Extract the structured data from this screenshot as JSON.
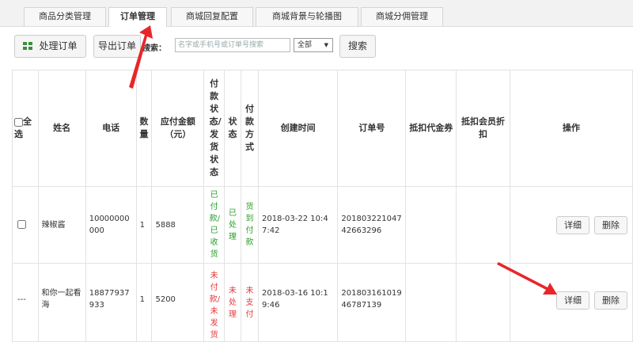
{
  "tabs": [
    {
      "label": "商品分类管理"
    },
    {
      "label": "订单管理"
    },
    {
      "label": "商城回复配置"
    },
    {
      "label": "商城背景与轮播图"
    },
    {
      "label": "商城分佣管理"
    }
  ],
  "toolbar": {
    "process_label": "处理订单",
    "export_label": "导出订单",
    "search_label": "搜索：",
    "search_placeholder": "名字或手机号或订单号搜索",
    "filter_value": "全部",
    "search_button": "搜索"
  },
  "table": {
    "headers": {
      "select_all": "全选",
      "name": "姓名",
      "phone": "电话",
      "qty": "数量",
      "amount": "应付金额（元）",
      "pay_ship_status": "付款状态/发货状态",
      "status": "状态",
      "pay_method": "付款方式",
      "created": "创建时间",
      "order_no": "订单号",
      "deduct_coupon": "抵扣代金券",
      "deduct_member": "抵扣会员折扣",
      "actions": "操作"
    },
    "rows": [
      {
        "name": "辣椒酱",
        "phone": "10000000000",
        "qty": "1",
        "amount": "5888",
        "pay_ship_status": "已付款/已收货",
        "status": "已处理",
        "pay_method": "货到付款",
        "created": "2018-03-22 10:47:42",
        "order_no": "20180322104742663296",
        "detail_label": "详细",
        "delete_label": "删除"
      },
      {
        "select_text": "---",
        "name": "和你一起看海",
        "phone": "18877937933",
        "qty": "1",
        "amount": "5200",
        "pay_ship_status": "未付款/未发货",
        "status": "未处理",
        "pay_method": "未支付",
        "created": "2018-03-16 10:19:46",
        "order_no": "20180316101946787139",
        "detail_label": "详细",
        "delete_label": "删除"
      }
    ]
  },
  "colors": {
    "paid_green": "#2aa02a",
    "unpaid_red": "#e4393c",
    "annotation_arrow": "#e8262a"
  }
}
